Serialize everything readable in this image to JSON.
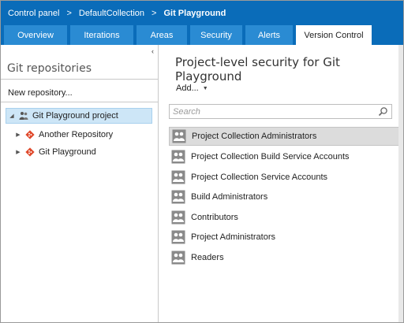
{
  "breadcrumb": {
    "items": [
      "Control panel",
      "DefaultCollection",
      "Git Playground"
    ],
    "separator": ">"
  },
  "tabs": [
    {
      "label": "Overview",
      "active": false
    },
    {
      "label": "Iterations",
      "active": false
    },
    {
      "label": "Areas",
      "active": false
    },
    {
      "label": "Security",
      "active": false
    },
    {
      "label": "Alerts",
      "active": false
    },
    {
      "label": "Version Control",
      "active": true
    }
  ],
  "left": {
    "collapse_glyph": "‹",
    "title": "Git repositories",
    "new_repo_label": "New repository...",
    "tree": {
      "root": {
        "label": "Git Playground project",
        "icon": "team-project-icon",
        "expanded": true,
        "selected": true
      },
      "children": [
        {
          "label": "Another Repository",
          "icon": "git-repo-icon",
          "expanded": false
        },
        {
          "label": "Git Playground",
          "icon": "git-repo-icon",
          "expanded": false
        }
      ]
    }
  },
  "right": {
    "title": "Project-level security for Git Playground",
    "add_label": "Add...",
    "search_placeholder": "Search",
    "groups": [
      {
        "label": "Project Collection Administrators",
        "selected": true
      },
      {
        "label": "Project Collection Build Service Accounts",
        "selected": false
      },
      {
        "label": "Project Collection Service Accounts",
        "selected": false
      },
      {
        "label": "Build Administrators",
        "selected": false
      },
      {
        "label": "Contributors",
        "selected": false
      },
      {
        "label": "Project Administrators",
        "selected": false
      },
      {
        "label": "Readers",
        "selected": false
      }
    ]
  },
  "colors": {
    "header_bg": "#0a6cb9",
    "tab_bg": "#2a8bd3",
    "tree_selected_bg": "#cde6f7",
    "git_icon": "#e0492b"
  }
}
